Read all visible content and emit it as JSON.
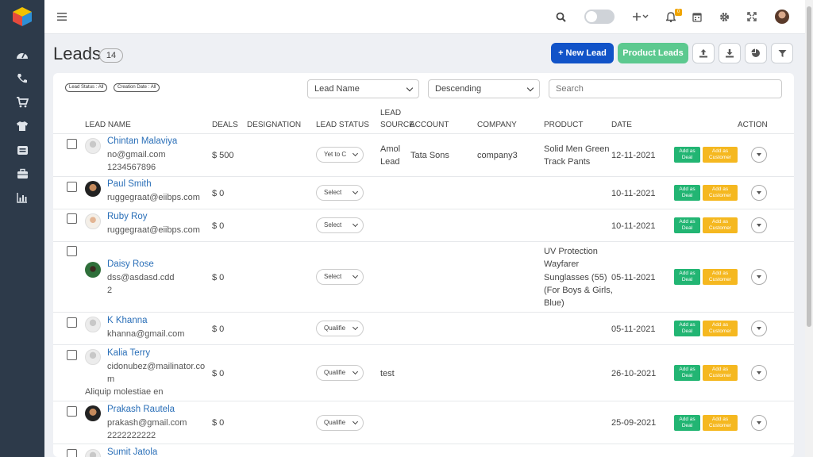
{
  "page": {
    "title": "Leads",
    "count": "14"
  },
  "colors": {
    "sidebar": "#2d3a4a",
    "primary": "#1153c8",
    "success": "#5cc98f",
    "deal": "#22b573",
    "customer": "#f5b820",
    "link": "#2a6fb8"
  },
  "sidebar": {
    "icons": [
      "dashboard-icon",
      "phone-icon",
      "cart-icon",
      "shirt-icon",
      "inbox-icon",
      "briefcase-icon",
      "bar-chart-icon"
    ]
  },
  "topbar": {
    "icons": [
      "menu-icon",
      "search-icon",
      "toggle",
      "plus-icon",
      "bell-icon",
      "calendar-icon",
      "gear-icon",
      "fullscreen-icon",
      "avatar"
    ],
    "notification_count": "0"
  },
  "actions": {
    "new_lead": "+ New Lead",
    "product_leads": "Product Leads"
  },
  "filters": {
    "lead_status": "Lead Status : All",
    "creation_date": "Creation Date : All",
    "sort_field": "Lead Name",
    "sort_order": "Descending",
    "search_placeholder": "Search"
  },
  "columns": {
    "lead_name": "LEAD NAME",
    "deals": "DEALS",
    "designation": "DESIGNATION",
    "lead_status": "LEAD STATUS",
    "lead_source_1": "LEAD",
    "lead_source_2": "SOURCE",
    "account": "ACCOUNT",
    "company": "COMPANY",
    "product": "PRODUCT",
    "date": "DATE",
    "action": "ACTION"
  },
  "row_buttons": {
    "deal_1": "Add as",
    "deal_2": "Deal",
    "cust_1": "Add as",
    "cust_2": "Customer"
  },
  "rows": [
    {
      "name": "Chintan Malaviya",
      "email": "no@gmail.com",
      "extra": "1234567896",
      "deals": "$ 500",
      "status": "Yet to C",
      "source_1": "Amol",
      "source_2": "Lead",
      "account": "Tata Sons",
      "company": "company3",
      "product_1": "Solid Men Green",
      "product_2": "Track Pants",
      "date": "12-11-2021"
    },
    {
      "name": "Paul Smith",
      "email": "ruggegraat@eiibps.com",
      "deals": "$ 0",
      "status": "Select",
      "date": "10-11-2021"
    },
    {
      "name": "Ruby Roy",
      "email": "ruggegraat@eiibps.com",
      "deals": "$ 0",
      "status": "Select",
      "date": "10-11-2021"
    },
    {
      "name": "Daisy Rose",
      "email": "dss@asdasd.cdd",
      "extra": "2",
      "deals": "$ 0",
      "status": "Select",
      "product_1": "UV Protection",
      "product_2": "Wayfarer",
      "product_3": "Sunglasses (55)",
      "product_4": "(For Boys & Girls,",
      "product_5": "Blue)",
      "date": "05-11-2021"
    },
    {
      "name": "K Khanna",
      "email": "khanna@gmail.com",
      "deals": "$ 0",
      "status": "Qualifie",
      "date": "05-11-2021"
    },
    {
      "name": "Kalia Terry",
      "email_1": "cidonubez@mailinator.co",
      "email_2": "m",
      "extra": "Aliquip molestiae en",
      "deals": "$ 0",
      "status": "Qualifie",
      "source_1": "test",
      "date": "26-10-2021"
    },
    {
      "name": "Prakash Rautela",
      "email": "prakash@gmail.com",
      "extra": "2222222222",
      "deals": "$ 0",
      "status": "Qualifie",
      "date": "25-09-2021"
    },
    {
      "name": "Sumit Jatola"
    }
  ]
}
